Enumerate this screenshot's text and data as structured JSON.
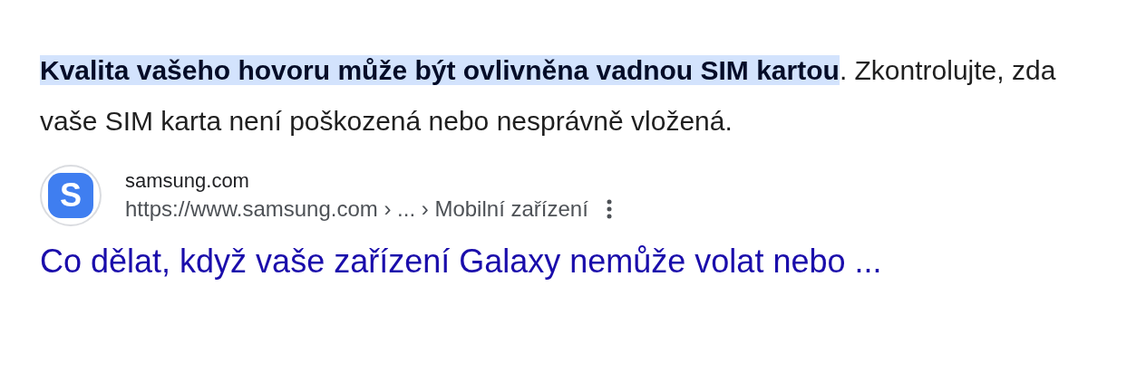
{
  "snippet": {
    "text": "**Kvalita vašeho hovoru může být ovlivněna vadnou SIM kartou**. Zkontrolujte, zda vaše SIM karta není poškozená nebo nesprávně vložená."
  },
  "source": {
    "logo_letter": "S",
    "site": "samsung.com",
    "url": "https://www.samsung.com › ... › Mobilní zařízení"
  },
  "result": {
    "title": "Co dělat, když vaše zařízení Galaxy nemůže volat nebo ..."
  }
}
